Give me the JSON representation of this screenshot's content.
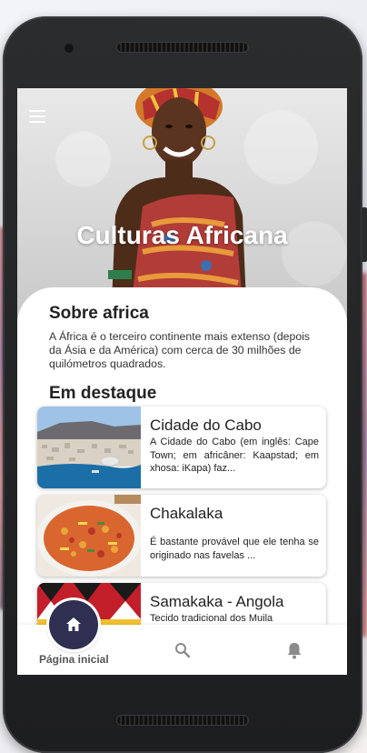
{
  "hero": {
    "title": "Culturas Africana"
  },
  "about": {
    "title": "Sobre africa",
    "text": "A África é o terceiro continente mais extenso (depois da Ásia e da América) com cerca de 30 milhões de quilómetros quadrados."
  },
  "featured": {
    "title": "Em destaque",
    "items": [
      {
        "title": "Cidade do Cabo",
        "description": " A Cidade do Cabo (em inglês: Cape Town; em africâner: Kaapstad; em xhosa: iKapa) faz..."
      },
      {
        "title": "Chakalaka",
        "description": " É bastante provável que ele tenha se originado nas favelas ..."
      },
      {
        "title": "Samakaka - Angola",
        "description": " Tecido tradicional dos Muila"
      }
    ]
  },
  "bottom_nav": {
    "home_label": "Página inicial",
    "icons": [
      "home-icon",
      "search-icon",
      "bell-icon"
    ]
  },
  "colors": {
    "fab": "#2e2f51",
    "hero_text": "#ffffff"
  }
}
